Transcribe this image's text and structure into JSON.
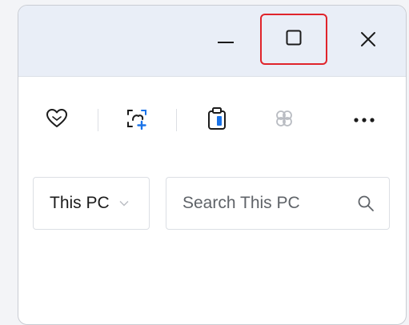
{
  "window": {
    "caption": {
      "minimize_icon": "minimize-icon",
      "maximize_icon": "maximize-icon",
      "close_icon": "close-icon",
      "highlight_color": "#e0242b"
    },
    "toolbar": {
      "items": [
        {
          "icon": "favorite-heart-icon"
        },
        {
          "icon": "photo-add-icon",
          "accent": "#1a73e8"
        },
        {
          "icon": "clipboard-icon"
        },
        {
          "icon": "clover-icon",
          "disabled": true
        },
        {
          "icon": "more-icon"
        }
      ]
    },
    "address": {
      "location": "This PC",
      "chevron_icon": "chevron-down-icon"
    },
    "search": {
      "placeholder": "Search This PC",
      "icon": "search-icon"
    }
  }
}
